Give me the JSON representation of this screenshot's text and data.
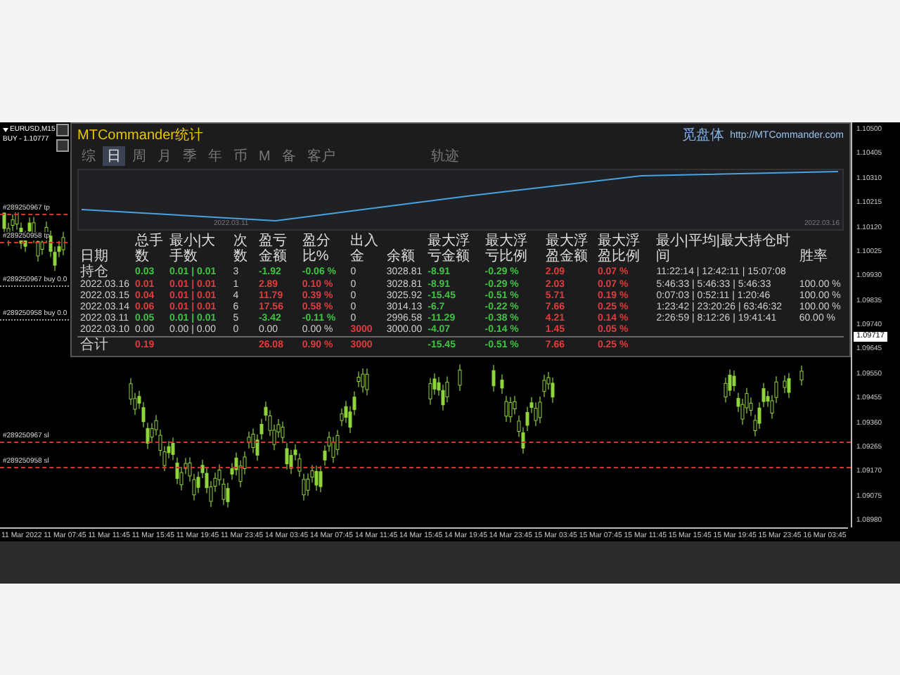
{
  "chart_header": {
    "symbol": "EURUSD,M15",
    "signal": "BUY - 1.10777"
  },
  "order_lines": [
    {
      "label": "#289250967 tp",
      "kind": "tp"
    },
    {
      "label": "#289250958 tp",
      "kind": "tp"
    },
    {
      "label": "#289250967 buy 0.0",
      "kind": "buy"
    },
    {
      "label": "#289250958 buy 0.0",
      "kind": "buy"
    },
    {
      "label": "#289250967 sl",
      "kind": "sl"
    },
    {
      "label": "#289250958 sl",
      "kind": "sl"
    }
  ],
  "panel": {
    "title": "MTCommander统计",
    "brand": "觅盘体",
    "link": "http://MTCommander.com",
    "tabs": [
      {
        "label": "综",
        "selected": false
      },
      {
        "label": "日",
        "selected": true
      },
      {
        "label": "周",
        "selected": false
      },
      {
        "label": "月",
        "selected": false
      },
      {
        "label": "季",
        "selected": false
      },
      {
        "label": "年",
        "selected": false
      },
      {
        "label": "币",
        "selected": false
      },
      {
        "label": "M",
        "selected": false
      },
      {
        "label": "备",
        "selected": false
      },
      {
        "label": "客户",
        "selected": false
      }
    ],
    "extra_tab": {
      "label": "轨迹",
      "selected": false
    },
    "equity_dates": [
      "2022.03.11",
      "2022.03.16"
    ],
    "table": {
      "columns": [
        "日期",
        "总手数",
        "最小|大手数",
        "次数",
        "盈亏金额",
        "盈分比%",
        "出入金",
        "余额",
        "最大浮亏金额",
        "最大浮亏比例",
        "最大浮盈金额",
        "最大浮盈比例",
        "最小|平均|最大持仓时间",
        "胜率"
      ],
      "rows": [
        {
          "cells": [
            {
              "text": "持仓"
            },
            {
              "text": "0.03",
              "color": "#3ec43e"
            },
            {
              "text": "0.01 | 0.01",
              "color": "#3ec43e"
            },
            {
              "text": "3"
            },
            {
              "text": "-1.92",
              "color": "#3ec43e"
            },
            {
              "text": "-0.06 %",
              "color": "#3ec43e"
            },
            {
              "text": "0"
            },
            {
              "text": "3028.81"
            },
            {
              "text": "-8.91",
              "color": "#3ec43e"
            },
            {
              "text": "-0.29 %",
              "color": "#3ec43e"
            },
            {
              "text": "2.09",
              "color": "#e23b3b"
            },
            {
              "text": "0.07 %",
              "color": "#e23b3b"
            },
            {
              "text": "11:22:14 | 12:42:11 | 15:07:08"
            },
            {
              "text": ""
            }
          ]
        },
        {
          "cells": [
            {
              "text": "2022.03.16"
            },
            {
              "text": "0.01",
              "color": "#e23b3b"
            },
            {
              "text": "0.01 | 0.01",
              "color": "#e23b3b"
            },
            {
              "text": "1"
            },
            {
              "text": "2.89",
              "color": "#e23b3b"
            },
            {
              "text": "0.10 %",
              "color": "#e23b3b"
            },
            {
              "text": "0"
            },
            {
              "text": "3028.81"
            },
            {
              "text": "-8.91",
              "color": "#3ec43e"
            },
            {
              "text": "-0.29 %",
              "color": "#3ec43e"
            },
            {
              "text": "2.03",
              "color": "#e23b3b"
            },
            {
              "text": "0.07 %",
              "color": "#e23b3b"
            },
            {
              "text": "5:46:33 | 5:46:33 | 5:46:33"
            },
            {
              "text": "100.00 %"
            }
          ]
        },
        {
          "cells": [
            {
              "text": "2022.03.15"
            },
            {
              "text": "0.04",
              "color": "#e23b3b"
            },
            {
              "text": "0.01 | 0.01",
              "color": "#e23b3b"
            },
            {
              "text": "4"
            },
            {
              "text": "11.79",
              "color": "#e23b3b"
            },
            {
              "text": "0.39 %",
              "color": "#e23b3b"
            },
            {
              "text": "0"
            },
            {
              "text": "3025.92"
            },
            {
              "text": "-15.45",
              "color": "#3ec43e"
            },
            {
              "text": "-0.51 %",
              "color": "#3ec43e"
            },
            {
              "text": "5.71",
              "color": "#e23b3b"
            },
            {
              "text": "0.19 %",
              "color": "#e23b3b"
            },
            {
              "text": "0:07:03 | 0:52:11 | 1:20:46"
            },
            {
              "text": "100.00 %"
            }
          ]
        },
        {
          "cells": [
            {
              "text": "2022.03.14"
            },
            {
              "text": "0.06",
              "color": "#e23b3b"
            },
            {
              "text": "0.01 | 0.01",
              "color": "#e23b3b"
            },
            {
              "text": "6"
            },
            {
              "text": "17.56",
              "color": "#e23b3b"
            },
            {
              "text": "0.58 %",
              "color": "#e23b3b"
            },
            {
              "text": "0"
            },
            {
              "text": "3014.13"
            },
            {
              "text": "-6.7",
              "color": "#3ec43e"
            },
            {
              "text": "-0.22 %",
              "color": "#3ec43e"
            },
            {
              "text": "7.66",
              "color": "#e23b3b"
            },
            {
              "text": "0.25 %",
              "color": "#e23b3b"
            },
            {
              "text": "1:23:42 | 23:20:26 | 63:46:32"
            },
            {
              "text": "100.00 %"
            }
          ]
        },
        {
          "cells": [
            {
              "text": "2022.03.11"
            },
            {
              "text": "0.05",
              "color": "#3ec43e"
            },
            {
              "text": "0.01 | 0.01",
              "color": "#3ec43e"
            },
            {
              "text": "5"
            },
            {
              "text": "-3.42",
              "color": "#3ec43e"
            },
            {
              "text": "-0.11 %",
              "color": "#3ec43e"
            },
            {
              "text": "0"
            },
            {
              "text": "2996.58"
            },
            {
              "text": "-11.29",
              "color": "#3ec43e"
            },
            {
              "text": "-0.38 %",
              "color": "#3ec43e"
            },
            {
              "text": "4.21",
              "color": "#e23b3b"
            },
            {
              "text": "0.14 %",
              "color": "#e23b3b"
            },
            {
              "text": "2:26:59 | 8:12:26 | 19:41:41"
            },
            {
              "text": "60.00 %"
            }
          ]
        },
        {
          "cells": [
            {
              "text": "2022.03.10"
            },
            {
              "text": "0.00"
            },
            {
              "text": "0.00 | 0.00"
            },
            {
              "text": "0"
            },
            {
              "text": "0.00"
            },
            {
              "text": "0.00 %"
            },
            {
              "text": "3000",
              "color": "#e23b3b"
            },
            {
              "text": "3000.00"
            },
            {
              "text": "-4.07",
              "color": "#3ec43e"
            },
            {
              "text": "-0.14 %",
              "color": "#3ec43e"
            },
            {
              "text": "1.45",
              "color": "#e23b3b"
            },
            {
              "text": "0.05 %",
              "color": "#e23b3b"
            },
            {
              "text": ""
            },
            {
              "text": ""
            }
          ]
        },
        {
          "cells": [
            {
              "text": "合计"
            },
            {
              "text": "0.19",
              "color": "#e23b3b"
            },
            {
              "text": ""
            },
            {
              "text": ""
            },
            {
              "text": "26.08",
              "color": "#e23b3b"
            },
            {
              "text": "0.90 %",
              "color": "#e23b3b"
            },
            {
              "text": "3000",
              "color": "#e23b3b"
            },
            {
              "text": ""
            },
            {
              "text": "-15.45",
              "color": "#3ec43e"
            },
            {
              "text": "-0.51 %",
              "color": "#3ec43e"
            },
            {
              "text": "7.66",
              "color": "#e23b3b"
            },
            {
              "text": "0.25 %",
              "color": "#e23b3b"
            },
            {
              "text": ""
            },
            {
              "text": ""
            }
          ]
        }
      ]
    }
  },
  "price_axis": [
    "1.10500",
    "1.10405",
    "1.10310",
    "1.10215",
    "1.10120",
    "1.10025",
    "1.09930",
    "1.09835",
    "1.09740",
    "1.09645",
    "1.09550",
    "1.09455",
    "1.09360",
    "1.09265",
    "1.09170",
    "1.09075",
    "1.08980"
  ],
  "current_price": "1.09717",
  "time_axis": [
    "11 Mar 2022",
    "11 Mar 07:45",
    "11 Mar 11:45",
    "11 Mar 15:45",
    "11 Mar 19:45",
    "11 Mar 23:45",
    "14 Mar 03:45",
    "14 Mar 07:45",
    "14 Mar 11:45",
    "14 Mar 15:45",
    "14 Mar 19:45",
    "14 Mar 23:45",
    "15 Mar 03:45",
    "15 Mar 07:45",
    "15 Mar 11:45",
    "15 Mar 15:45",
    "15 Mar 19:45",
    "15 Mar 23:45",
    "16 Mar 03:45"
  ]
}
